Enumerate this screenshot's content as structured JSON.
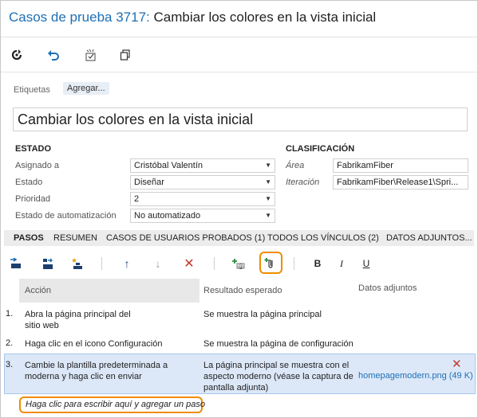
{
  "title": {
    "prefix": "Casos de prueba 3717:",
    "text": "Cambiar los colores en la vista inicial"
  },
  "toolbar": {
    "icons": [
      "refresh-icon",
      "undo-icon",
      "edit-query-icon",
      "copy-icon"
    ]
  },
  "tags": {
    "label": "Etiquetas",
    "add_label": "Agregar..."
  },
  "case_title": "Cambiar los colores en la vista inicial",
  "estado": {
    "heading": "ESTADO",
    "assigned_label": "Asignado a",
    "assigned_value": "Cristóbal Valentín",
    "state_label": "Estado",
    "state_value": "Diseñar",
    "priority_label": "Prioridad",
    "priority_value": "2",
    "automation_label": "Estado de automatización",
    "automation_value": "No automatizado"
  },
  "clasificacion": {
    "heading": "CLASIFICACIÓN",
    "area_label": "Área",
    "area_value": "FabrikamFiber",
    "iteration_label": "Iteración",
    "iteration_value": "FabrikamFiber\\Release1\\Spri..."
  },
  "tabs": [
    {
      "label": "PASOS",
      "active": true
    },
    {
      "label": "RESUMEN",
      "active": false
    },
    {
      "label": "CASOS DE USUARIOS PROBADOS (1)",
      "active": false
    },
    {
      "label": "TODOS LOS VÍNCULOS (2)",
      "active": false
    },
    {
      "label": "DATOS ADJUNTOS...",
      "active": false
    }
  ],
  "steps_toolbar": {
    "bold": "B",
    "italic": "I",
    "underline": "U"
  },
  "grid": {
    "headers": {
      "action": "Acción",
      "expected": "Resultado esperado",
      "attachments": "Datos adjuntos"
    },
    "rows": [
      {
        "num": "1.",
        "action_1": "Abra la página principal del",
        "action_2": "sitio web",
        "expected_1": "Se muestra la página principal"
      },
      {
        "num": "2.",
        "action_1": "Haga clic en el icono Configuración",
        "expected_1": "Se muestra la página de configuración"
      },
      {
        "num": "3.",
        "action_1": "Cambie la plantilla predeterminada a",
        "action_2": "moderna y haga clic en enviar",
        "expected_1": "La página principal se muestra con el",
        "expected_2": "aspecto moderno (véase la captura de",
        "expected_3": "pantalla adjunta)",
        "attachment": "homepagemodern.png (49 K)"
      }
    ],
    "add_step": "Haga clic para escribir aquí y agregar un paso"
  },
  "colors": {
    "accent": "#1e6fb5",
    "highlight": "#ef8c00",
    "selected_row": "#dce8f8",
    "delete": "#c0392b"
  }
}
